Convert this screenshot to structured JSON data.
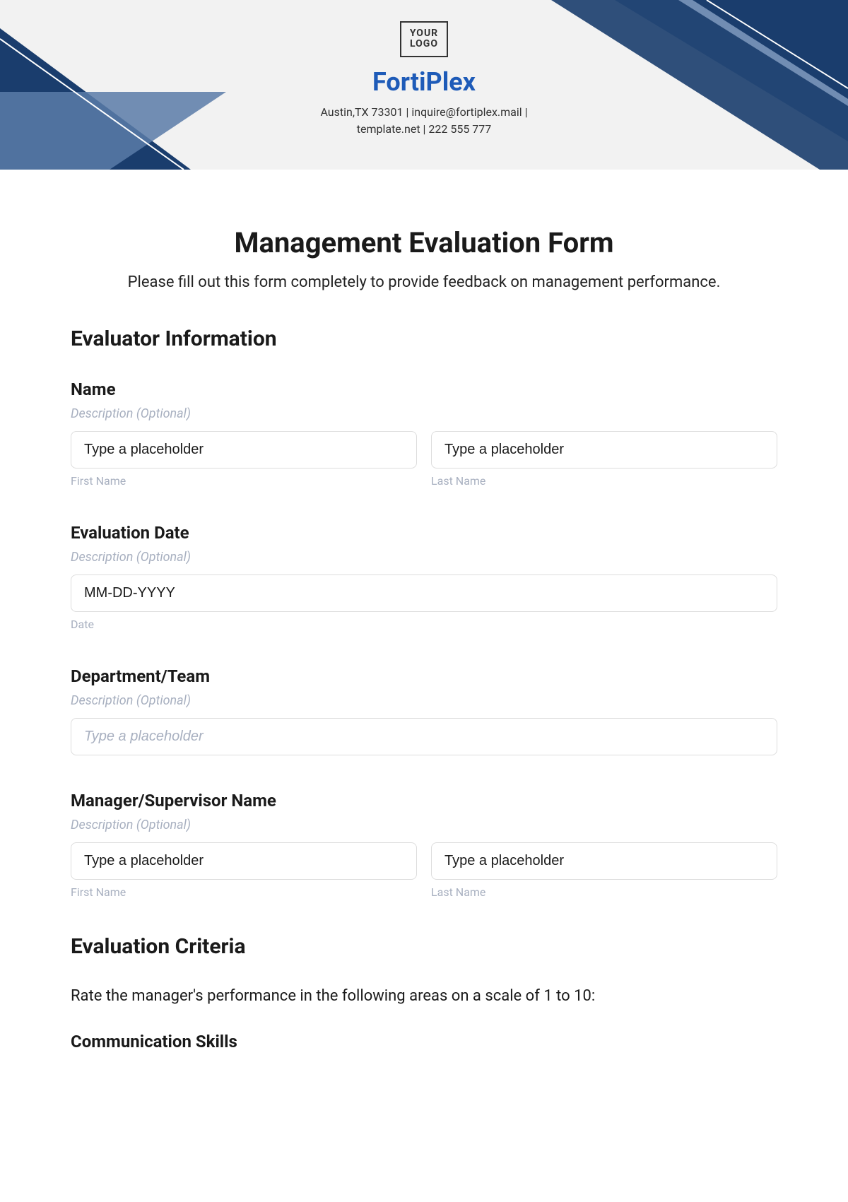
{
  "header": {
    "logo_text": "YOUR\nLOGO",
    "brand": "FortiPlex",
    "contact_line1": "Austin,TX 73301 | inquire@fortiplex.mail |",
    "contact_line2": "template.net | 222 555 777"
  },
  "form": {
    "title": "Management Evaluation Form",
    "subtitle": "Please fill out this form completely to provide feedback on management performance."
  },
  "section1": {
    "heading": "Evaluator Information"
  },
  "name": {
    "label": "Name",
    "desc": "Description (Optional)",
    "ph1": "Type a placeholder",
    "ph2": "Type a placeholder",
    "sub1": "First Name",
    "sub2": "Last Name"
  },
  "date": {
    "label": "Evaluation Date",
    "desc": "Description (Optional)",
    "ph": "MM-DD-YYYY",
    "sub": "Date"
  },
  "dept": {
    "label": "Department/Team",
    "desc": "Description (Optional)",
    "ph": "Type a placeholder"
  },
  "mgr": {
    "label": "Manager/Supervisor Name",
    "desc": "Description (Optional)",
    "ph1": "Type a placeholder",
    "ph2": "Type a placeholder",
    "sub1": "First Name",
    "sub2": "Last Name"
  },
  "criteria": {
    "heading": "Evaluation Criteria",
    "intro": "Rate the manager's performance in the following areas on a scale of 1 to 10:",
    "item1": "Communication Skills"
  }
}
